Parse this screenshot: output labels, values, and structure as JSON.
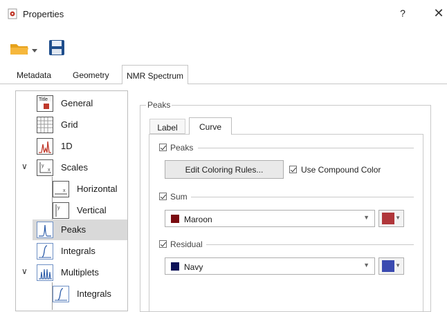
{
  "window": {
    "title": "Properties",
    "help_label": "?",
    "close_label": "✕"
  },
  "toolbar": {
    "open_icon": "folder-open-icon",
    "save_icon": "floppy-save-icon"
  },
  "tabs": [
    {
      "label": "Metadata"
    },
    {
      "label": "Geometry"
    },
    {
      "label": "NMR Spectrum",
      "active": true
    }
  ],
  "tree": {
    "items": [
      {
        "label": "General",
        "icon": "title-icon"
      },
      {
        "label": "Grid",
        "icon": "grid-icon"
      },
      {
        "label": "1D",
        "icon": "spectrum-1d-icon"
      },
      {
        "label": "Scales",
        "icon": "scales-icon",
        "expanded": true
      },
      {
        "label": "Horizontal",
        "icon": "horizontal-scale-icon"
      },
      {
        "label": "Vertical",
        "icon": "vertical-scale-icon"
      },
      {
        "label": "Peaks",
        "icon": "peak-icon",
        "selected": true
      },
      {
        "label": "Integrals",
        "icon": "integral-icon"
      },
      {
        "label": "Multiplets",
        "icon": "multiplet-icon",
        "expanded": true
      },
      {
        "label": "Integrals",
        "icon": "integral-icon"
      }
    ]
  },
  "peaks_group": {
    "legend": "Peaks",
    "subtabs": [
      {
        "label": "Label"
      },
      {
        "label": "Curve",
        "active": true
      }
    ],
    "peaks_check": {
      "label": "Peaks",
      "checked": true
    },
    "edit_button": "Edit Coloring Rules...",
    "compound_check": {
      "label": "Use Compound Color",
      "checked": true
    },
    "sum": {
      "label": "Sum",
      "checked": true,
      "color_name": "Maroon",
      "color": "#7a0b10",
      "button_color": "#b0363a"
    },
    "residual": {
      "label": "Residual",
      "checked": true,
      "color_name": "Navy",
      "color": "#0c1257",
      "button_color": "#3a4ab0"
    }
  }
}
